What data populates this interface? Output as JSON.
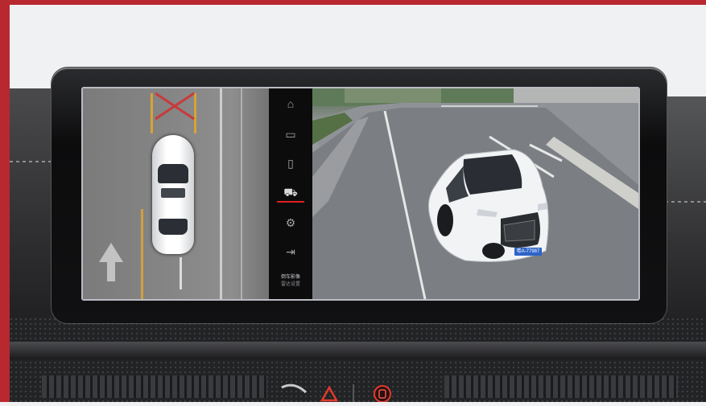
{
  "screen": {
    "active_view": "panoramic-camera",
    "menu": {
      "items": [
        {
          "icon": "camera-front-icon"
        },
        {
          "icon": "panorama-view-icon"
        },
        {
          "icon": "camera-rear-icon"
        },
        {
          "icon": "car-3d-view-icon",
          "active": true
        },
        {
          "icon": "settings-icon"
        },
        {
          "icon": "exit-icon"
        }
      ],
      "label_line1": "倒车影像",
      "label_line2": "雷达设置"
    },
    "license_plate": "粤A-77987"
  },
  "colors": {
    "frame": "#b8282f",
    "active": "#e02020",
    "lane": "#d9a335",
    "warning": "#e23a2a"
  }
}
